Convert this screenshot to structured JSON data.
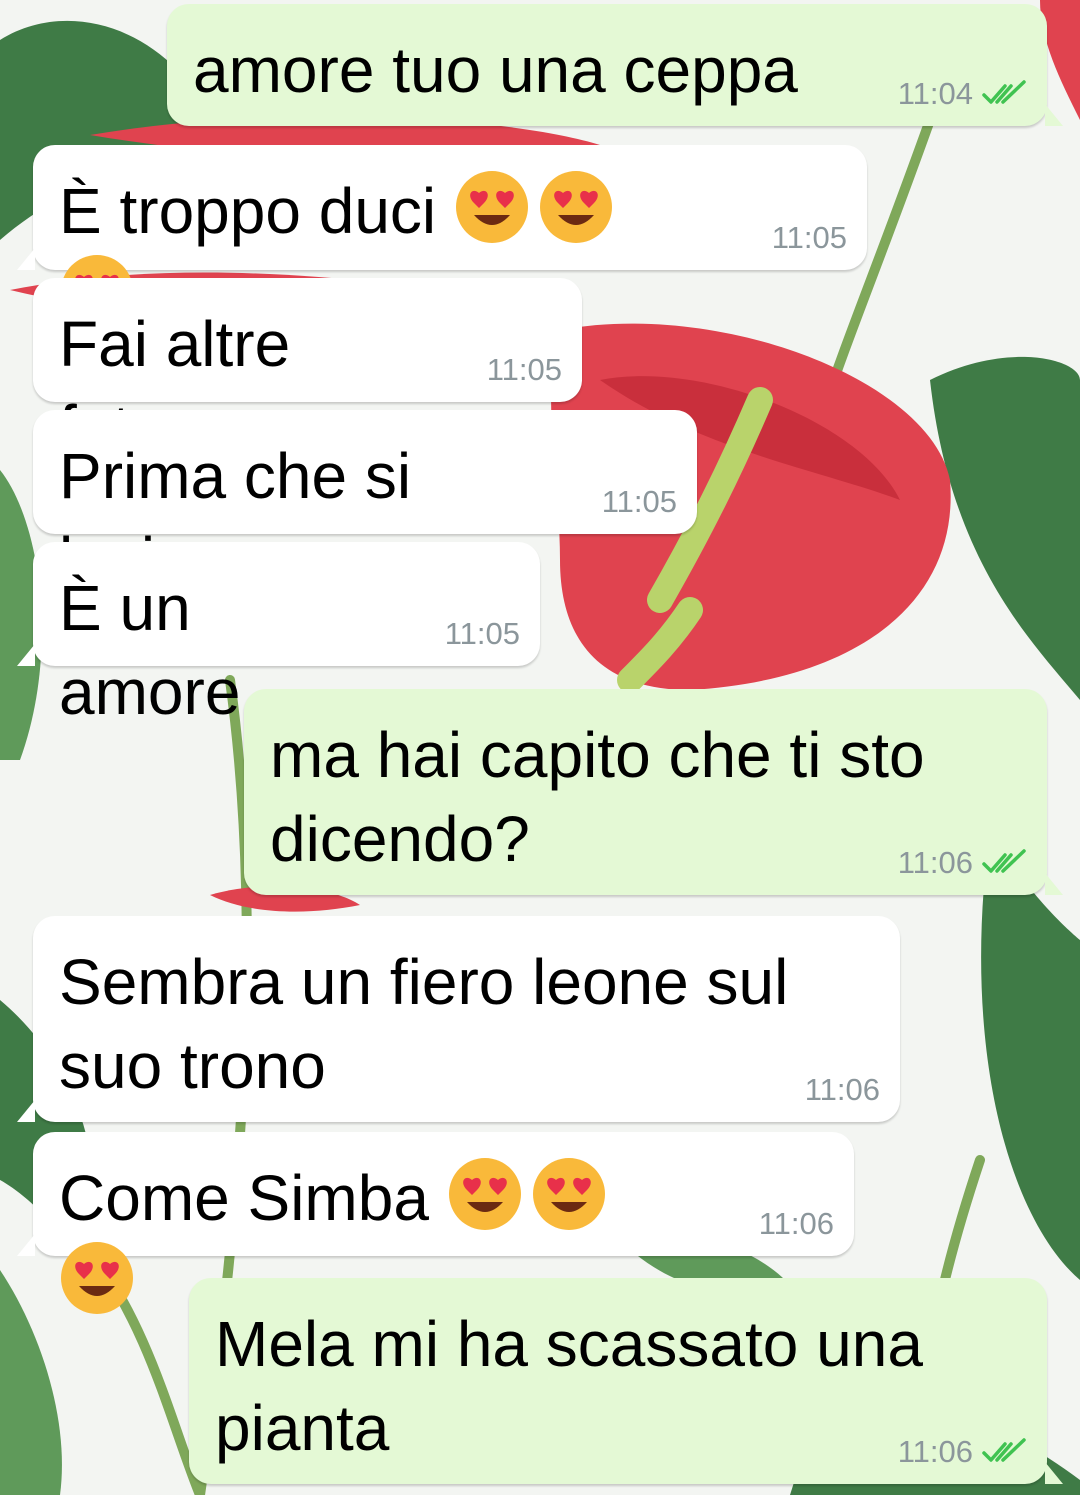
{
  "colors": {
    "outgoing_bubble": "#e4f9d5",
    "incoming_bubble": "#ffffff",
    "timestamp": "#8b969b",
    "read_check": "#40c351"
  },
  "icons": {
    "emoji": "smiling-face-with-heart-eyes",
    "read_receipt": "double-check-icon"
  },
  "messages": [
    {
      "direction": "out",
      "text": "amore tuo una ceppa",
      "time": "11:04",
      "read": true
    },
    {
      "direction": "in",
      "text": "È troppo duci",
      "emoji_count": 3,
      "time": "11:05"
    },
    {
      "direction": "in",
      "text": "Fai altre foto",
      "time": "11:05"
    },
    {
      "direction": "in",
      "text": "Prima che si levi",
      "time": "11:05"
    },
    {
      "direction": "in",
      "text": "È un amore",
      "time": "11:05"
    },
    {
      "direction": "out",
      "text": "ma hai capito che ti sto dicendo?",
      "time": "11:06",
      "read": true
    },
    {
      "direction": "in",
      "text": "Sembra un fiero leone sul suo trono",
      "time": "11:06"
    },
    {
      "direction": "in",
      "text": "Come Simba",
      "emoji_count": 3,
      "time": "11:06"
    },
    {
      "direction": "out",
      "text": "Mela mi ha scassato una pianta",
      "time": "11:06",
      "read": true
    }
  ]
}
